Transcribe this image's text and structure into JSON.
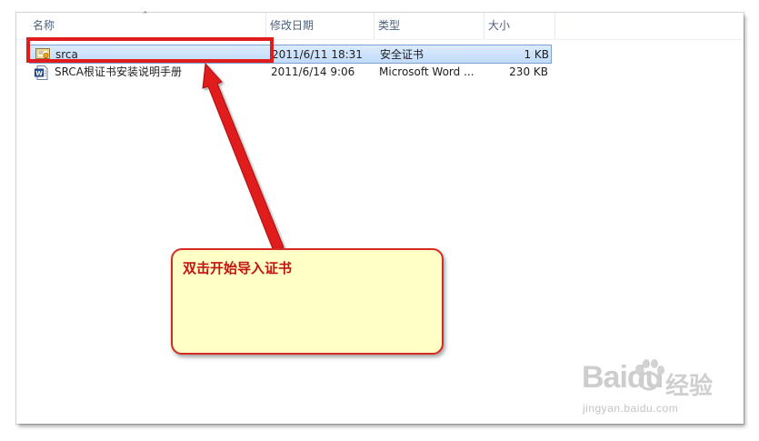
{
  "columns": {
    "name": "名称",
    "modified": "修改日期",
    "type": "类型",
    "size": "大小"
  },
  "files": [
    {
      "name": "srca",
      "modified": "2011/6/11 18:31",
      "type": "安全证书",
      "size": "1 KB",
      "icon": "certificate-icon",
      "selected": true
    },
    {
      "name": "SRCA根证书安装说明手册",
      "modified": "2011/6/14 9:06",
      "type": "Microsoft Word ...",
      "size": "230 KB",
      "icon": "word-document-icon",
      "selected": false
    }
  ],
  "callout": {
    "text": "双击开始导入证书"
  },
  "watermark": {
    "brand": "Baidu",
    "brand_cn": "经验",
    "url": "jingyan.baidu.com"
  },
  "colors": {
    "annotation_red": "#e11c1c",
    "callout_bg": "#ffffc6",
    "selection_bg": "#c9e0fb"
  }
}
